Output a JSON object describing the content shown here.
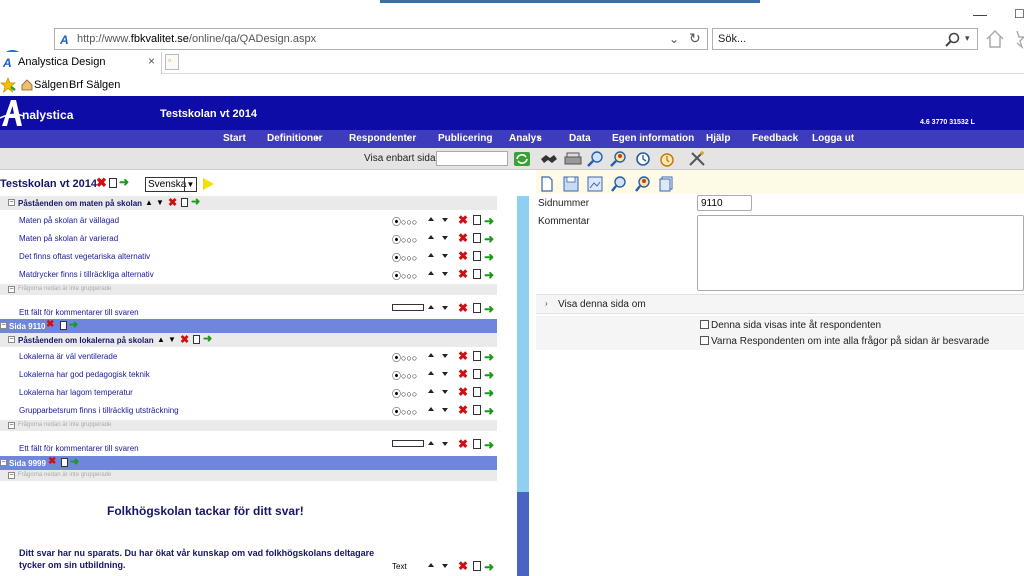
{
  "browser": {
    "url_prefix": "http://www.",
    "url_host": "fbkvalitet.se",
    "url_path": "/online/qa/QADesign.aspx",
    "search_placeholder": "Sök...",
    "tab_title": "Analystica Design",
    "favorites": [
      "Sälgen",
      "Brf Sälgen"
    ]
  },
  "app": {
    "logo": "nalystica",
    "title": "Testskolan vt 2014",
    "version": "4.6 3770 31532 L",
    "menu": [
      "Start",
      "Definitioner",
      "Respondenter",
      "Publicering",
      "Analys",
      "Data",
      "Egen information",
      "Hjälp",
      "Feedback",
      "Logga ut"
    ],
    "show_only_page_label": "Visa enbart sida"
  },
  "survey": {
    "title": "Testskolan vt 2014",
    "language": "Svenska",
    "section1": {
      "title": "Påståenden om maten på skolan",
      "questions": [
        "Maten på skolan är vällagad",
        "Maten på skolan är varierad",
        "Det finns oftast vegetariska alternativ",
        "Matdrycker finns i tillräckliga alternativ"
      ]
    },
    "hint_text": "Frågorna nedan är inte grupperade",
    "comment_field": "Ett fält för kommentarer till svaren",
    "page1": "Sida 9110",
    "section2": {
      "title": "Påståenden om lokalerna på skolan",
      "questions": [
        "Lokalerna är väl ventilerade",
        "Lokalerna har god pedagogisk teknik",
        "Lokalerna har lagom temperatur",
        "Grupparbetsrum finns i tillräcklig utsträckning"
      ]
    },
    "page2": "Sida 9999",
    "thanks": "Folkhögskolan tackar för ditt svar!",
    "saved_line1": "Ditt svar har nu sparats. Du har ökat vår kunskap om vad folkhögskolans deltagare",
    "saved_line2": "tycker om sin utbildning.",
    "text_label": "Text",
    "radio_symbols": "⦿○○○"
  },
  "details": {
    "page_number_label": "Sidnummer",
    "page_number_value": "9110",
    "comment_label": "Kommentar",
    "show_page_label": "Visa denna sida om",
    "check1": "Denna sida visas inte åt respondenten",
    "check2": "Varna Respondenten om inte alla frågor på sidan är besvarade"
  },
  "colors": {
    "header": "#0e0ca6",
    "menu": "#3e3bbd",
    "page_row": "#6f86dd",
    "question_text": "#1a1a9a"
  }
}
